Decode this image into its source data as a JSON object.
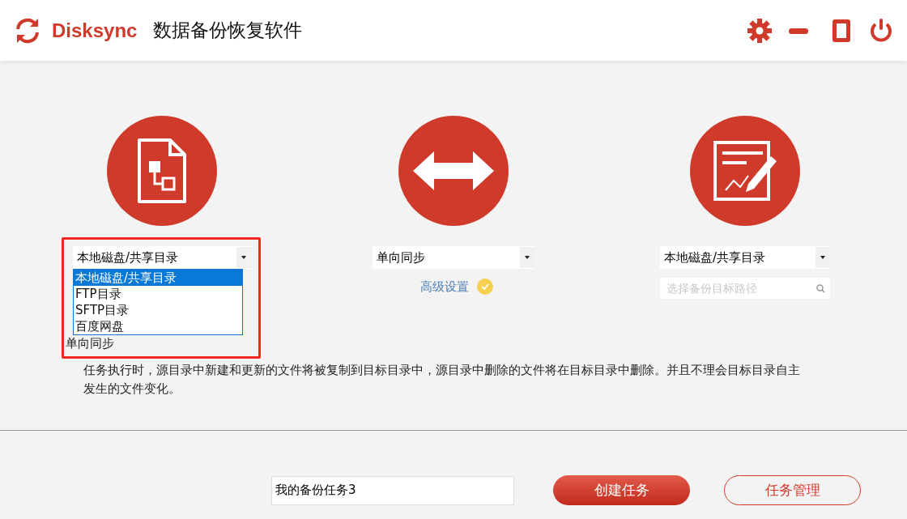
{
  "header": {
    "logo_text": "Disksync",
    "title": "数据备份恢复软件"
  },
  "source": {
    "select_value": "本地磁盘/共享目录",
    "dropdown_open": true,
    "options": [
      {
        "label": "本地磁盘/共享目录",
        "selected": true
      },
      {
        "label": "FTP目录",
        "selected": false
      },
      {
        "label": "SFTP目录",
        "selected": false
      },
      {
        "label": "百度网盘",
        "selected": false
      }
    ],
    "highlighted": true
  },
  "mode": {
    "select_value": "单向同步",
    "advanced_label": "高级设置",
    "advanced_checked": true
  },
  "target": {
    "select_value": "本地磁盘/共享目录",
    "path_placeholder": "选择备份目标路径"
  },
  "mode_title": "单向同步",
  "description": "任务执行时，源目录中新建和更新的文件将被复制到目标目录中，源目录中删除的文件将在目标目录中删除。并且不理会目标目录自主发生的文件变化。",
  "task_name": "我的备份任务3",
  "buttons": [
    {
      "label": "创建任务",
      "kind": "primary"
    },
    {
      "label": "任务管理",
      "kind": "outline"
    }
  ]
}
